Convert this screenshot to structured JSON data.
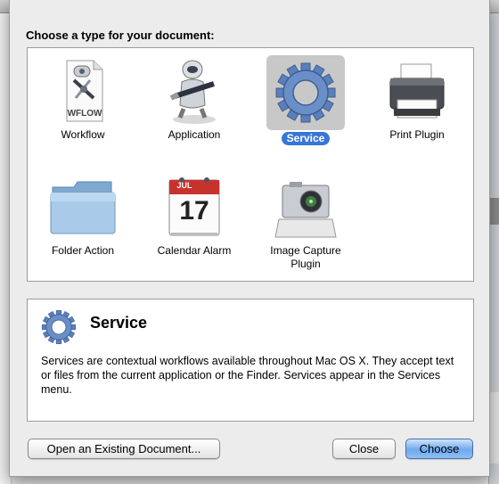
{
  "sheet": {
    "title": "Choose a type for your document:",
    "types": [
      {
        "label": "Workflow",
        "icon": "workflow-icon",
        "selected": false
      },
      {
        "label": "Application",
        "icon": "application-icon",
        "selected": false
      },
      {
        "label": "Service",
        "icon": "service-gear-icon",
        "selected": true
      },
      {
        "label": "Print Plugin",
        "icon": "printer-icon",
        "selected": false
      },
      {
        "label": "Folder Action",
        "icon": "folder-icon",
        "selected": false
      },
      {
        "label": "Calendar Alarm",
        "icon": "calendar-icon",
        "selected": false
      },
      {
        "label": "Image Capture Plugin",
        "icon": "camera-icon",
        "selected": false
      }
    ],
    "workflow_icon_text": "WFLOW",
    "calendar_month": "JUL",
    "calendar_day": "17",
    "description": {
      "title": "Service",
      "text": "Services are contextual workflows available throughout Mac OS X. They accept text or files from the current application or the Finder. Services appear in the Services menu."
    },
    "buttons": {
      "open_existing": "Open an Existing Document...",
      "close": "Close",
      "choose": "Choose"
    }
  },
  "colors": {
    "selection": "#3875d7",
    "default_button": "#6fa8ee"
  }
}
